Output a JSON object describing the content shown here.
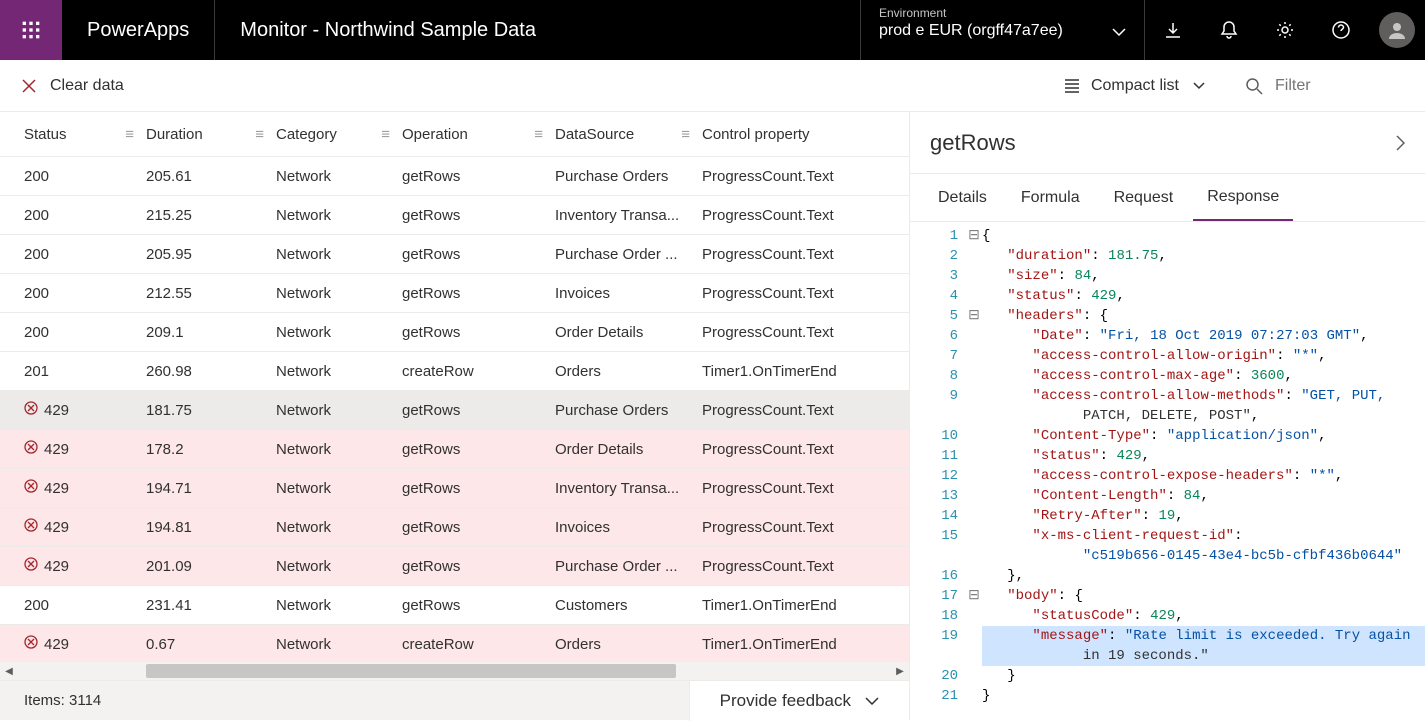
{
  "header": {
    "app": "PowerApps",
    "title": "Monitor - Northwind Sample Data",
    "env_label": "Environment",
    "env_name": "prod e EUR (orgff47a7ee)"
  },
  "toolbar": {
    "clear": "Clear data",
    "compact": "Compact list",
    "filter_placeholder": "Filter"
  },
  "grid": {
    "cols": {
      "status": "Status",
      "duration": "Duration",
      "category": "Category",
      "operation": "Operation",
      "dataSource": "DataSource",
      "control": "Control property"
    },
    "rows": [
      {
        "status": "200",
        "dur": "205.61",
        "cat": "Network",
        "op": "getRows",
        "ds": "Purchase Orders",
        "ctrl": "ProgressCount.Text",
        "err": false
      },
      {
        "status": "200",
        "dur": "215.25",
        "cat": "Network",
        "op": "getRows",
        "ds": "Inventory Transa...",
        "ctrl": "ProgressCount.Text",
        "err": false
      },
      {
        "status": "200",
        "dur": "205.95",
        "cat": "Network",
        "op": "getRows",
        "ds": "Purchase Order ...",
        "ctrl": "ProgressCount.Text",
        "err": false
      },
      {
        "status": "200",
        "dur": "212.55",
        "cat": "Network",
        "op": "getRows",
        "ds": "Invoices",
        "ctrl": "ProgressCount.Text",
        "err": false
      },
      {
        "status": "200",
        "dur": "209.1",
        "cat": "Network",
        "op": "getRows",
        "ds": "Order Details",
        "ctrl": "ProgressCount.Text",
        "err": false
      },
      {
        "status": "201",
        "dur": "260.98",
        "cat": "Network",
        "op": "createRow",
        "ds": "Orders",
        "ctrl": "Timer1.OnTimerEnd",
        "err": false
      },
      {
        "status": "429",
        "dur": "181.75",
        "cat": "Network",
        "op": "getRows",
        "ds": "Purchase Orders",
        "ctrl": "ProgressCount.Text",
        "err": true,
        "sel": true
      },
      {
        "status": "429",
        "dur": "178.2",
        "cat": "Network",
        "op": "getRows",
        "ds": "Order Details",
        "ctrl": "ProgressCount.Text",
        "err": true
      },
      {
        "status": "429",
        "dur": "194.71",
        "cat": "Network",
        "op": "getRows",
        "ds": "Inventory Transa...",
        "ctrl": "ProgressCount.Text",
        "err": true
      },
      {
        "status": "429",
        "dur": "194.81",
        "cat": "Network",
        "op": "getRows",
        "ds": "Invoices",
        "ctrl": "ProgressCount.Text",
        "err": true
      },
      {
        "status": "429",
        "dur": "201.09",
        "cat": "Network",
        "op": "getRows",
        "ds": "Purchase Order ...",
        "ctrl": "ProgressCount.Text",
        "err": true
      },
      {
        "status": "200",
        "dur": "231.41",
        "cat": "Network",
        "op": "getRows",
        "ds": "Customers",
        "ctrl": "Timer1.OnTimerEnd",
        "err": false
      },
      {
        "status": "429",
        "dur": "0.67",
        "cat": "Network",
        "op": "createRow",
        "ds": "Orders",
        "ctrl": "Timer1.OnTimerEnd",
        "err": true
      }
    ],
    "items_count": "Items: 3114",
    "feedback": "Provide feedback"
  },
  "details": {
    "title": "getRows",
    "tabs": {
      "details": "Details",
      "formula": "Formula",
      "request": "Request",
      "response": "Response"
    },
    "response": {
      "duration": 181.75,
      "size": 84,
      "status": 429,
      "headers": {
        "Date": "Fri, 18 Oct 2019 07:27:03 GMT",
        "access-control-allow-origin": "*",
        "access-control-max-age": 3600,
        "access-control-allow-methods": "GET, PUT, PATCH, DELETE, POST",
        "Content-Type": "application/json",
        "status": 429,
        "access-control-expose-headers": "*",
        "Content-Length": 84,
        "Retry-After": 19,
        "x-ms-client-request-id": "c519b656-0145-43e4-bc5b-cfbf436b0644"
      },
      "body": {
        "statusCode": 429,
        "message": "Rate limit is exceeded. Try again in 19 seconds."
      }
    }
  }
}
